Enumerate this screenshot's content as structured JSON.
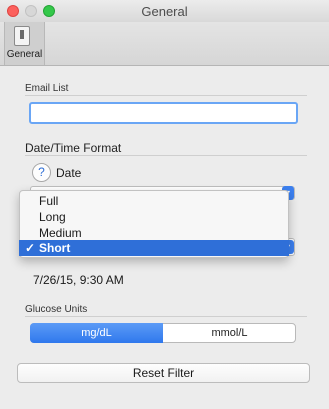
{
  "window": {
    "title": "General"
  },
  "toolbar": {
    "general_label": "General"
  },
  "email": {
    "section_label": "Email List",
    "value": ""
  },
  "datetime": {
    "section_label": "Date/Time Format",
    "help_glyph": "?",
    "date_label": "Date",
    "menu_items": [
      "Full",
      "Long",
      "Medium",
      "Short"
    ],
    "selected": "Short",
    "check_glyph": "✓",
    "example": "7/26/15, 9:30 AM"
  },
  "glucose": {
    "section_label": "Glucose Units",
    "options": [
      "mg/dL",
      "mmol/L"
    ],
    "selected": "mg/dL"
  },
  "actions": {
    "reset_label": "Reset Filter"
  },
  "colors": {
    "accent": "#2f6fd8",
    "focus_ring": "#6aa6f5"
  }
}
